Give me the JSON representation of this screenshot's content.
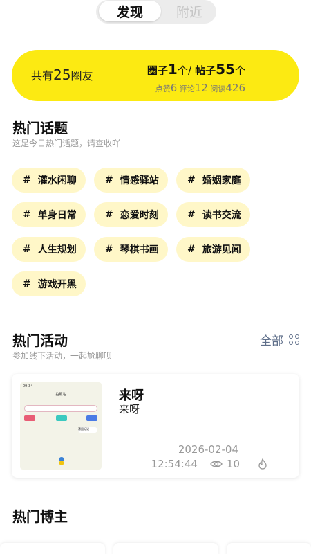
{
  "segment": {
    "active": "发现",
    "inactive": "附近"
  },
  "stats": {
    "prefix": "共有",
    "members": "25",
    "members_unit": "圈友",
    "circles_label": "圈子",
    "circles": "1",
    "circles_unit": "个/",
    "posts_label": "帖子",
    "posts": "55",
    "posts_unit": "个",
    "likes_label": "点赞",
    "likes": "6",
    "comments_label": "评论",
    "comments": "12",
    "reads_label": "阅读",
    "reads": "426"
  },
  "hot_topics": {
    "title": "热门话题",
    "subtitle": "这是今日热门话题，请查收吖",
    "hash": "#",
    "tags": [
      "灌水闲聊",
      "情感驿站",
      "婚姻家庭",
      "单身日常",
      "恋爱时刻",
      "读书交流",
      "人生规划",
      "琴棋书画",
      "旅游见闻",
      "游戏开黑"
    ]
  },
  "hot_activities": {
    "title": "热门活动",
    "subtitle": "参加线下活动，一起尬聊呗",
    "all_label": "全部",
    "card": {
      "title": "来呀",
      "description": "来呀",
      "date": "2026-02-04",
      "time": "12:54:44",
      "views": "10",
      "thumb_time": "09:34",
      "thumb_title": "拍照站",
      "thumb_chip": "漂图标记"
    }
  },
  "hot_bloggers": {
    "title": "热门博主"
  },
  "colors": {
    "accent": "#fcea12",
    "tag_bg": "#fff7c8",
    "link": "#5f6f8a"
  }
}
